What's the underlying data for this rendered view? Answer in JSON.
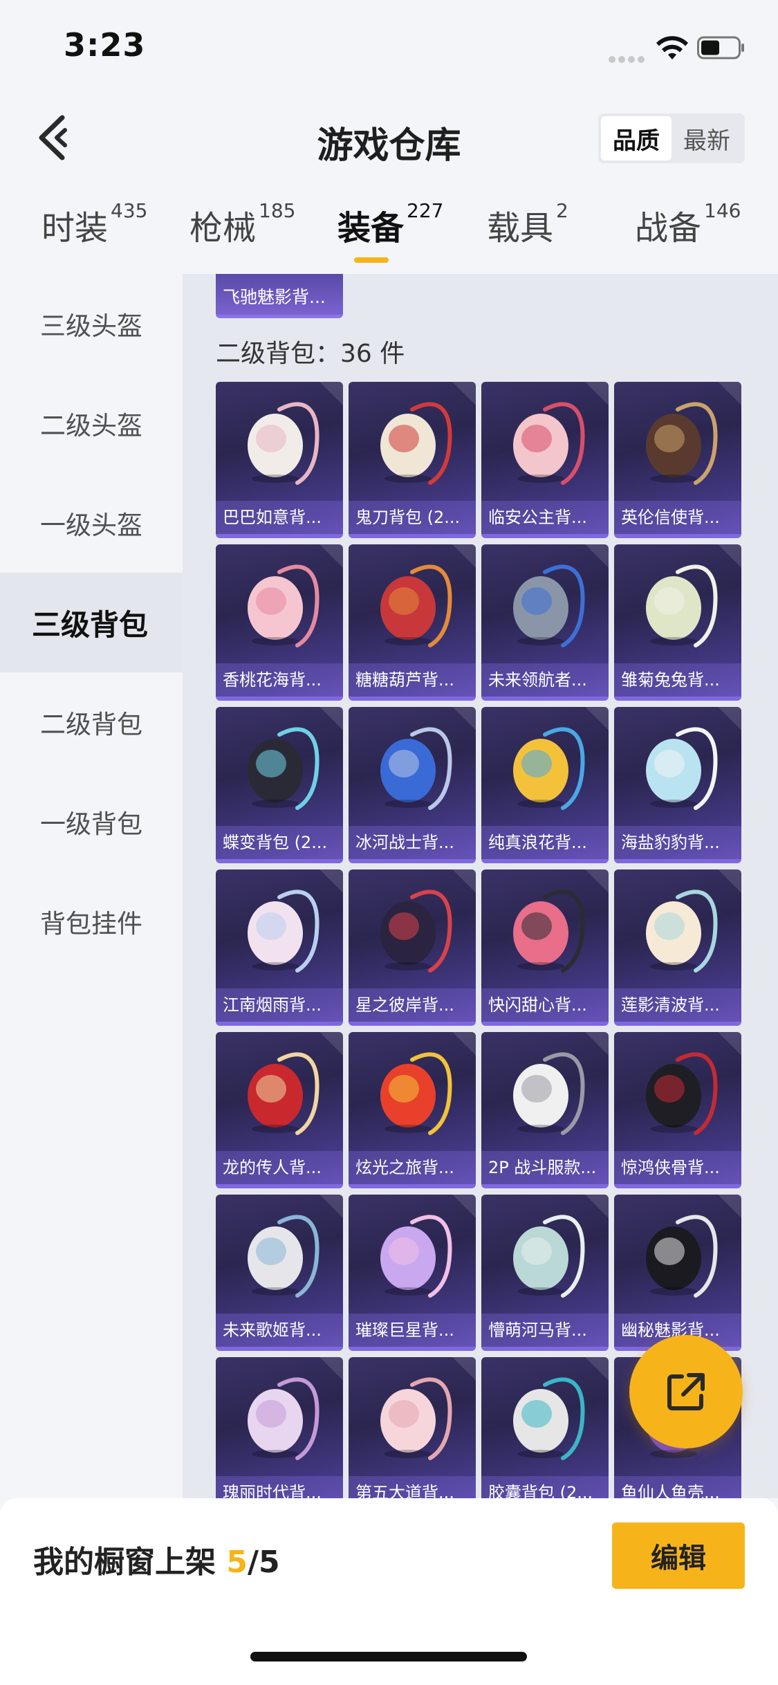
{
  "status_bar": {
    "time": "3:23"
  },
  "header": {
    "title": "游戏仓库",
    "sort_options": [
      {
        "label": "品质",
        "active": true
      },
      {
        "label": "最新",
        "active": false
      }
    ]
  },
  "tabs": [
    {
      "label": "时装",
      "count": "435",
      "active": false
    },
    {
      "label": "枪械",
      "count": "185",
      "active": false
    },
    {
      "label": "装备",
      "count": "227",
      "active": true
    },
    {
      "label": "载具",
      "count": "2",
      "active": false
    },
    {
      "label": "战备",
      "count": "146",
      "active": false
    }
  ],
  "sidebar": {
    "items": [
      {
        "label": "三级头盔",
        "active": false
      },
      {
        "label": "二级头盔",
        "active": false
      },
      {
        "label": "一级头盔",
        "active": false
      },
      {
        "label": "三级背包",
        "active": true
      },
      {
        "label": "二级背包",
        "active": false
      },
      {
        "label": "一级背包",
        "active": false
      },
      {
        "label": "背包挂件",
        "active": false
      }
    ]
  },
  "content": {
    "partial_item": "飞驰魅影背...",
    "section_title": "二级背包：36 件",
    "items": [
      {
        "name": "巴巴如意背...",
        "icon": "white-fox-backpack-icon"
      },
      {
        "name": "鬼刀背包 (2...",
        "icon": "winged-backpack-icon"
      },
      {
        "name": "临安公主背...",
        "icon": "flower-backpack-icon"
      },
      {
        "name": "英伦信使背...",
        "icon": "clock-backpack-icon"
      },
      {
        "name": "香桃花海背...",
        "icon": "pink-ruffle-backpack-icon"
      },
      {
        "name": "糖糖葫芦背...",
        "icon": "red-gourd-backpack-icon"
      },
      {
        "name": "未来领航者...",
        "icon": "mech-backpack-icon"
      },
      {
        "name": "雏菊兔兔背...",
        "icon": "daisy-bunny-backpack-icon"
      },
      {
        "name": "蝶变背包 (2...",
        "icon": "butterfly-backpack-icon"
      },
      {
        "name": "冰河战士背...",
        "icon": "blue-camo-backpack-icon"
      },
      {
        "name": "纯真浪花背...",
        "icon": "wave-bottle-backpack-icon"
      },
      {
        "name": "海盐豹豹背...",
        "icon": "seal-backpack-icon"
      },
      {
        "name": "江南烟雨背...",
        "icon": "bow-round-backpack-icon"
      },
      {
        "name": "星之彼岸背...",
        "icon": "galaxy-pod-backpack-icon"
      },
      {
        "name": "快闪甜心背...",
        "icon": "pink-speaker-backpack-icon"
      },
      {
        "name": "莲影清波背...",
        "icon": "lotus-pouch-backpack-icon"
      },
      {
        "name": "龙的传人背...",
        "icon": "red-dragon-backpack-icon"
      },
      {
        "name": "炫光之旅背...",
        "icon": "gumball-backpack-icon"
      },
      {
        "name": "2P 战斗服款...",
        "icon": "white-emblem-backpack-icon"
      },
      {
        "name": "惊鸿侠骨背...",
        "icon": "dark-red-backpack-icon"
      },
      {
        "name": "未来歌姬背...",
        "icon": "idol-backpack-icon"
      },
      {
        "name": "璀璨巨星背...",
        "icon": "heart-backpack-icon"
      },
      {
        "name": "懵萌河马背...",
        "icon": "hippo-backpack-icon"
      },
      {
        "name": "幽秘魅影背...",
        "icon": "black-heart-backpack-icon"
      },
      {
        "name": "瑰丽时代背...",
        "icon": "lilac-bow-backpack-icon"
      },
      {
        "name": "第五大道背...",
        "icon": "quilted-pink-backpack-icon"
      },
      {
        "name": "胶囊背包 (2...",
        "icon": "capsule-backpack-icon"
      },
      {
        "name": "鱼仙人鱼壳...",
        "icon": "purple-shell-backpack-icon"
      }
    ]
  },
  "bottom_bar": {
    "showcase_label": "我的橱窗上架",
    "showcase_current": "5",
    "showcase_total": "/5",
    "edit_label": "编辑"
  },
  "colors": {
    "accent": "#f5b518",
    "card_bg": "#2b2650",
    "card_border": "#7f68e0"
  }
}
